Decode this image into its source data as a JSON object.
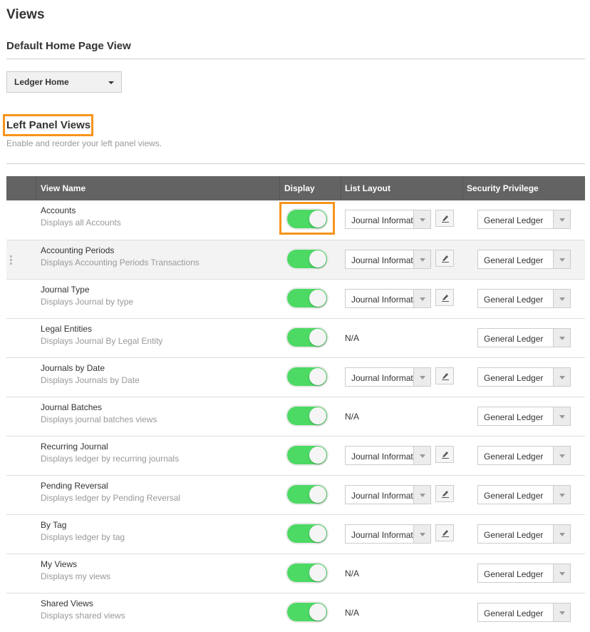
{
  "page": {
    "title": "Views",
    "default_section_title": "Default Home Page View",
    "default_home_view": "Ledger Home",
    "left_panel_title": "Left Panel Views",
    "left_panel_subtitle": "Enable and reorder your left panel views.",
    "highlight_color": "#f7941d",
    "toggle_on_color": "#4cd964"
  },
  "table": {
    "headers": {
      "view_name": "View Name",
      "display": "Display",
      "list_layout": "List Layout",
      "security_privilege": "Security Privilege"
    },
    "rows": [
      {
        "name": "Accounts",
        "desc": "Displays all Accounts",
        "display": true,
        "layout": "Journal Information",
        "privilege": "General Ledger"
      },
      {
        "name": "Accounting Periods",
        "desc": "Displays Accounting Periods Transactions",
        "display": true,
        "layout": "Journal Information",
        "privilege": "General Ledger"
      },
      {
        "name": "Journal Type",
        "desc": "Displays Journal by type",
        "display": true,
        "layout": "Journal Information",
        "privilege": "General Ledger"
      },
      {
        "name": "Legal Entities",
        "desc": "Displays Journal By Legal Entity",
        "display": true,
        "layout": "N/A",
        "privilege": "General Ledger"
      },
      {
        "name": "Journals by Date",
        "desc": "Displays Journals by Date",
        "display": true,
        "layout": "Journal Information",
        "privilege": "General Ledger"
      },
      {
        "name": "Journal Batches",
        "desc": "Displays journal batches views",
        "display": true,
        "layout": "N/A",
        "privilege": "General Ledger"
      },
      {
        "name": "Recurring Journal",
        "desc": "Displays ledger by recurring journals",
        "display": true,
        "layout": "Journal Information",
        "privilege": "General Ledger"
      },
      {
        "name": "Pending Reversal",
        "desc": "Displays ledger by Pending Reversal",
        "display": true,
        "layout": "Journal Information",
        "privilege": "General Ledger"
      },
      {
        "name": "By Tag",
        "desc": "Displays ledger by tag",
        "display": true,
        "layout": "Journal Information",
        "privilege": "General Ledger"
      },
      {
        "name": "My Views",
        "desc": "Displays my views",
        "display": true,
        "layout": "N/A",
        "privilege": "General Ledger"
      },
      {
        "name": "Shared Views",
        "desc": "Displays shared views",
        "display": true,
        "layout": "N/A",
        "privilege": "General Ledger"
      }
    ]
  }
}
